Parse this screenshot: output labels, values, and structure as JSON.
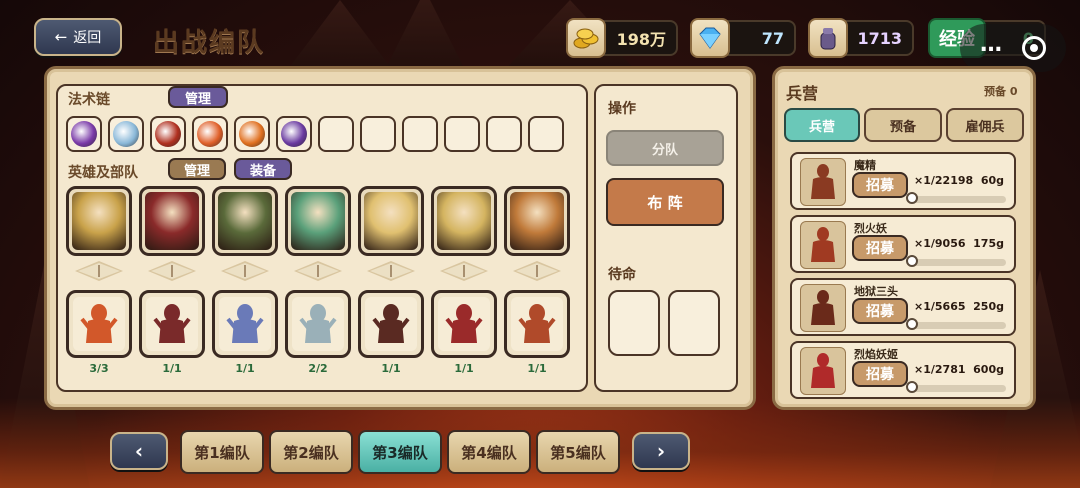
{
  "header": {
    "back_label": "返回",
    "back_icon": "arrow-left-icon",
    "title": "出战编队"
  },
  "resources": [
    {
      "name": "gold",
      "icon": "gold-coins-icon",
      "value": "198万",
      "color": "#f3e2b0"
    },
    {
      "name": "diamond",
      "icon": "diamond-icon",
      "value": "77",
      "color": "#bfe6ff"
    },
    {
      "name": "souls",
      "icon": "soul-jar-icon",
      "value": "1713",
      "color": "#e6d2ff"
    },
    {
      "name": "exp",
      "label": "经验",
      "value": "0",
      "color": "#6bd08a"
    }
  ],
  "overlay": {
    "more": "…"
  },
  "spells": {
    "label": "法术链",
    "manage": "管理",
    "items": [
      {
        "icon": "purple-vortex-icon",
        "color": "#7a3aa8"
      },
      {
        "icon": "ice-crystal-icon",
        "color": "#8ab8d8"
      },
      {
        "icon": "blood-swirl-icon",
        "color": "#b03020"
      },
      {
        "icon": "fire-burst-icon",
        "color": "#e0602a"
      },
      {
        "icon": "fireball-icon",
        "color": "#e07020"
      },
      {
        "icon": "arcane-hex-icon",
        "color": "#6a3aa0"
      },
      {
        "icon": "empty-slot"
      },
      {
        "icon": "empty-slot"
      },
      {
        "icon": "empty-slot"
      },
      {
        "icon": "empty-slot"
      },
      {
        "icon": "empty-slot"
      },
      {
        "icon": "empty-slot"
      }
    ]
  },
  "heroes": {
    "label": "英雄及部队",
    "manage": "管理",
    "equip": "装备",
    "items": [
      {
        "name": "hero-pharaoh-queen",
        "color": "#c9a24a"
      },
      {
        "name": "hero-red-sorceress",
        "color": "#8a2a2a"
      },
      {
        "name": "hero-treant",
        "color": "#5a6a3a"
      },
      {
        "name": "hero-elf-archer",
        "color": "#5aa07a"
      },
      {
        "name": "hero-golden-priestess",
        "color": "#e0c070"
      },
      {
        "name": "hero-golden-paladin",
        "color": "#d4b460"
      },
      {
        "name": "hero-lion-warrior",
        "color": "#c07a3a"
      }
    ]
  },
  "units": [
    {
      "name": "unit-fire-phoenix",
      "count": "3/3",
      "color": "#d2582a"
    },
    {
      "name": "unit-horned-demon",
      "count": "1/1",
      "color": "#7a2a2a"
    },
    {
      "name": "unit-naga-mage",
      "count": "1/1",
      "color": "#6a7ab8"
    },
    {
      "name": "unit-bone-dragon",
      "count": "2/2",
      "color": "#9ab0b8"
    },
    {
      "name": "unit-armored-demon",
      "count": "1/1",
      "color": "#5a2a22"
    },
    {
      "name": "unit-winged-demon",
      "count": "1/1",
      "color": "#9a2a2a"
    },
    {
      "name": "unit-fire-imp",
      "count": "1/1",
      "color": "#b04a2a"
    }
  ],
  "ops": {
    "label": "操作",
    "split": "分队",
    "formation": "布 阵",
    "standby": "待命"
  },
  "barracks": {
    "title": "兵营",
    "reserve": "预备 0",
    "tabs": [
      "兵营",
      "预备",
      "雇佣兵"
    ],
    "active_tab": 0,
    "recruit_label": "招募",
    "rows": [
      {
        "name": "魔精",
        "stock": "×1/22198",
        "price": "60g",
        "color": "#8a3a22",
        "level": 0
      },
      {
        "name": "烈火妖",
        "stock": "×1/9056",
        "price": "175g",
        "color": "#a03a22",
        "level": 0
      },
      {
        "name": "地狱三头",
        "stock": "×1/5665",
        "price": "250g",
        "color": "#6a2a1a",
        "level": 0
      },
      {
        "name": "烈焰妖姬",
        "stock": "×1/2781",
        "price": "600g",
        "color": "#b02a2a",
        "level": 0
      }
    ]
  },
  "teams": {
    "prev": "‹",
    "next": "›",
    "labels": [
      "第1编队",
      "第2编队",
      "第3编队",
      "第4编队",
      "第5编队"
    ],
    "active": 2
  }
}
